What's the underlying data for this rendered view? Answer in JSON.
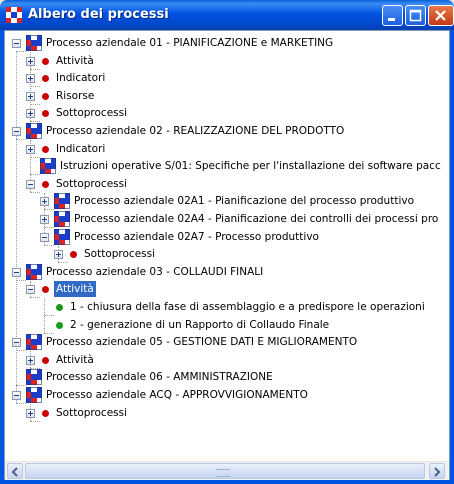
{
  "window": {
    "title": "Albero dei processi",
    "controls": [
      "minimize",
      "maximize",
      "close"
    ]
  },
  "colors": {
    "titlebar": "#0054e3",
    "selection": "#316ac5",
    "dot_red": "#c80000",
    "dot_green": "#1a9a1a"
  },
  "tree": {
    "nodes": [
      {
        "label": "Processo aziendale 01 - PIANIFICAZIONE e MARKETING",
        "icon": "process-icon",
        "expander": "minus"
      },
      {
        "label": "Attività",
        "icon": "red-dot-icon",
        "expander": "plus"
      },
      {
        "label": "Indicatori",
        "icon": "red-dot-icon",
        "expander": "plus"
      },
      {
        "label": "Risorse",
        "icon": "red-dot-icon",
        "expander": "plus"
      },
      {
        "label": "Sottoprocessi",
        "icon": "red-dot-icon",
        "expander": "plus"
      },
      {
        "label": "Processo aziendale 02 - REALIZZAZIONE DEL PRODOTTO",
        "icon": "process-icon",
        "expander": "minus"
      },
      {
        "label": "Indicatori",
        "icon": "red-dot-icon",
        "expander": "plus"
      },
      {
        "label": "Istruzioni operative S/01: Specifiche per l'installazione dei software pacc",
        "icon": "process-icon",
        "expander": "none"
      },
      {
        "label": "Sottoprocessi",
        "icon": "red-dot-icon",
        "expander": "minus"
      },
      {
        "label": "Processo aziendale 02A1 - Pianificazione del processo produttivo",
        "icon": "process-icon",
        "expander": "plus"
      },
      {
        "label": "Processo aziendale 02A4 - Pianificazione dei controlli dei processi pro",
        "icon": "process-icon",
        "expander": "plus"
      },
      {
        "label": "Processo aziendale 02A7 - Processo produttivo",
        "icon": "process-icon",
        "expander": "minus"
      },
      {
        "label": "Sottoprocessi",
        "icon": "red-dot-icon",
        "expander": "plus"
      },
      {
        "label": "Processo aziendale 03 - COLLAUDI FINALI",
        "icon": "process-icon",
        "expander": "minus"
      },
      {
        "label": "Attività",
        "icon": "red-dot-icon",
        "expander": "minus",
        "selected": true
      },
      {
        "label": "1 - chiusura della fase di assemblaggio e a predispore le operazioni",
        "icon": "green-dot-icon",
        "expander": "none"
      },
      {
        "label": "2 - generazione di un Rapporto di Collaudo Finale",
        "icon": "green-dot-icon",
        "expander": "none"
      },
      {
        "label": "Processo aziendale 05 - GESTIONE DATI E MIGLIORAMENTO",
        "icon": "process-icon",
        "expander": "minus"
      },
      {
        "label": "Attività",
        "icon": "red-dot-icon",
        "expander": "plus"
      },
      {
        "label": "Processo aziendale 06 - AMMINISTRAZIONE",
        "icon": "process-icon",
        "expander": "none"
      },
      {
        "label": "Processo aziendale ACQ - APPROVVIGIONAMENTO",
        "icon": "process-icon",
        "expander": "minus"
      },
      {
        "label": "Sottoprocessi",
        "icon": "red-dot-icon",
        "expander": "plus"
      }
    ]
  },
  "scrollbar": {
    "left_arrow": "left-arrow-icon",
    "right_arrow": "right-arrow-icon"
  }
}
